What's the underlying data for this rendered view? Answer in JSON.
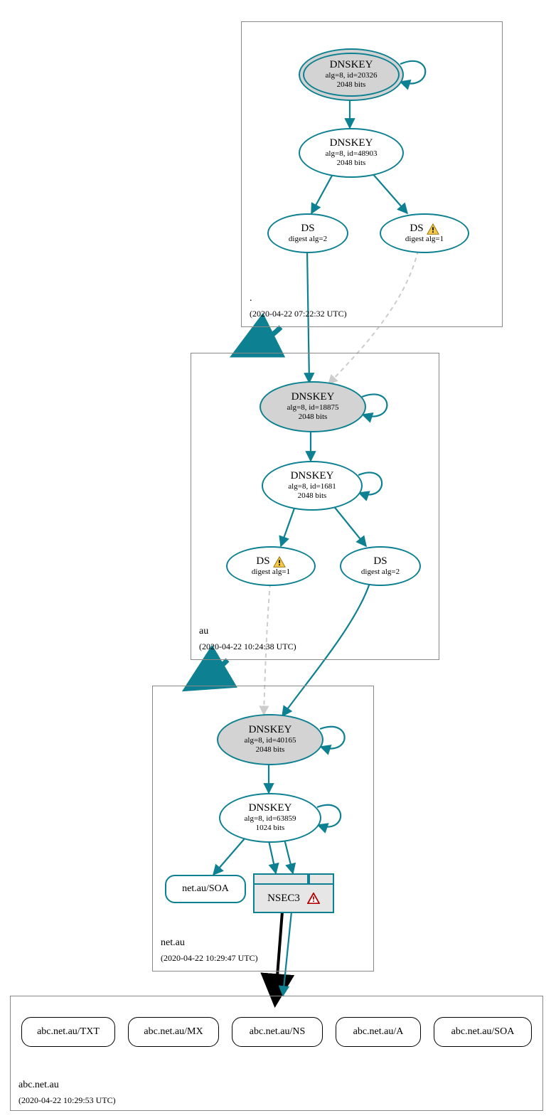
{
  "zones": {
    "root": {
      "name": ".",
      "timestamp": "(2020-04-22 07:22:32 UTC)"
    },
    "au": {
      "name": "au",
      "timestamp": "(2020-04-22 10:24:38 UTC)"
    },
    "netau": {
      "name": "net.au",
      "timestamp": "(2020-04-22 10:29:47 UTC)"
    },
    "abc": {
      "name": "abc.net.au",
      "timestamp": "(2020-04-22 10:29:53 UTC)"
    }
  },
  "nodes": {
    "root_ksk": {
      "title": "DNSKEY",
      "sub1": "alg=8, id=20326",
      "sub2": "2048 bits"
    },
    "root_zsk": {
      "title": "DNSKEY",
      "sub1": "alg=8, id=48903",
      "sub2": "2048 bits"
    },
    "root_ds2": {
      "title": "DS",
      "sub1": "digest alg=2"
    },
    "root_ds1": {
      "title": "DS",
      "sub1": "digest alg=1"
    },
    "au_ksk": {
      "title": "DNSKEY",
      "sub1": "alg=8, id=18875",
      "sub2": "2048 bits"
    },
    "au_zsk": {
      "title": "DNSKEY",
      "sub1": "alg=8, id=1681",
      "sub2": "2048 bits"
    },
    "au_ds1": {
      "title": "DS",
      "sub1": "digest alg=1"
    },
    "au_ds2": {
      "title": "DS",
      "sub1": "digest alg=2"
    },
    "netau_ksk": {
      "title": "DNSKEY",
      "sub1": "alg=8, id=40165",
      "sub2": "2048 bits"
    },
    "netau_zsk": {
      "title": "DNSKEY",
      "sub1": "alg=8, id=63859",
      "sub2": "1024 bits"
    },
    "netau_soa": {
      "title": "net.au/SOA"
    },
    "nsec3": {
      "title": "NSEC3"
    },
    "abc_txt": {
      "title": "abc.net.au/TXT"
    },
    "abc_mx": {
      "title": "abc.net.au/MX"
    },
    "abc_ns": {
      "title": "abc.net.au/NS"
    },
    "abc_a": {
      "title": "abc.net.au/A"
    },
    "abc_soa": {
      "title": "abc.net.au/SOA"
    }
  },
  "icons": {
    "warning": "warning-triangle",
    "error": "error-triangle"
  }
}
